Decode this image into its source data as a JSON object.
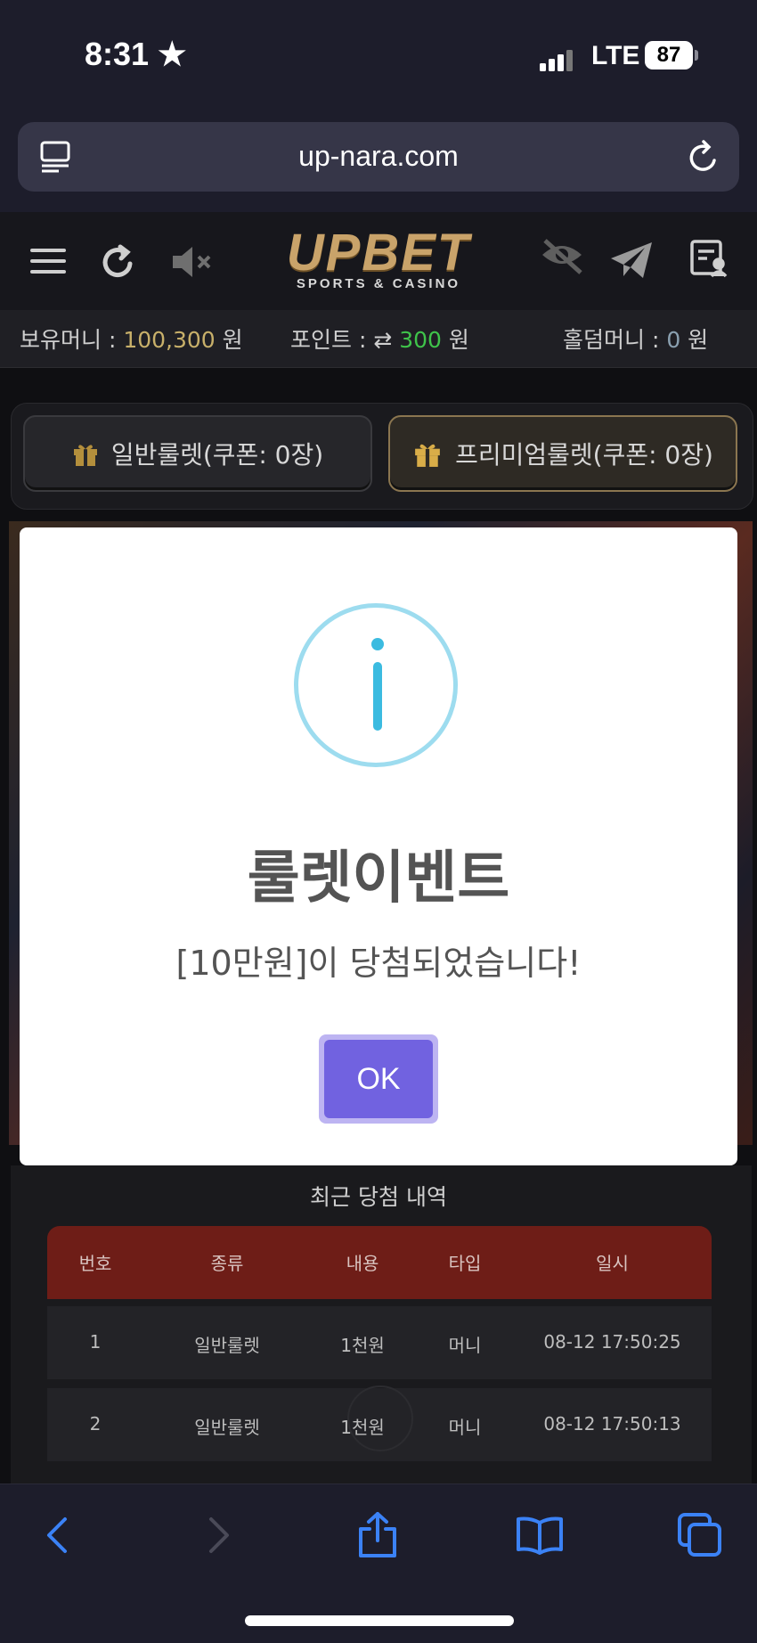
{
  "status_bar": {
    "time": "8:31",
    "star": "★",
    "network": "LTE",
    "battery": "87"
  },
  "browser": {
    "url": "up-nara.com"
  },
  "site": {
    "logo": "UPBET",
    "logo_sub": "SPORTS & CASINO"
  },
  "money": {
    "balance_label": "보유머니 : ",
    "balance_value": "100,300",
    "balance_unit": " 원",
    "point_label": "포인트 : ",
    "point_value": "300",
    "point_unit": " 원",
    "holdem_label": "홀덤머니 : ",
    "holdem_value": "0",
    "holdem_unit": " 원"
  },
  "tabs": [
    {
      "label": "일반룰렛(쿠폰: 0장)"
    },
    {
      "label": "프리미엄룰렛(쿠폰: 0장)"
    }
  ],
  "modal": {
    "title": "룰렛이벤트",
    "message": "[10만원]이 당첨되었습니다!",
    "ok_label": "OK"
  },
  "history": {
    "title": "최근 당첨 내역",
    "columns": [
      "번호",
      "종류",
      "내용",
      "타입",
      "일시"
    ],
    "rows": [
      [
        "1",
        "일반룰렛",
        "1천원",
        "머니",
        "08-12 17:50:25"
      ],
      [
        "2",
        "일반룰렛",
        "1천원",
        "머니",
        "08-12 17:50:13"
      ]
    ]
  },
  "colors": {
    "accent_gold": "#c8b06a",
    "point_green": "#3fc34a",
    "modal_button": "#7162e0",
    "info_blue": "#3bbbe0",
    "table_header": "#6e1d17",
    "ios_blue": "#3b82f6"
  }
}
